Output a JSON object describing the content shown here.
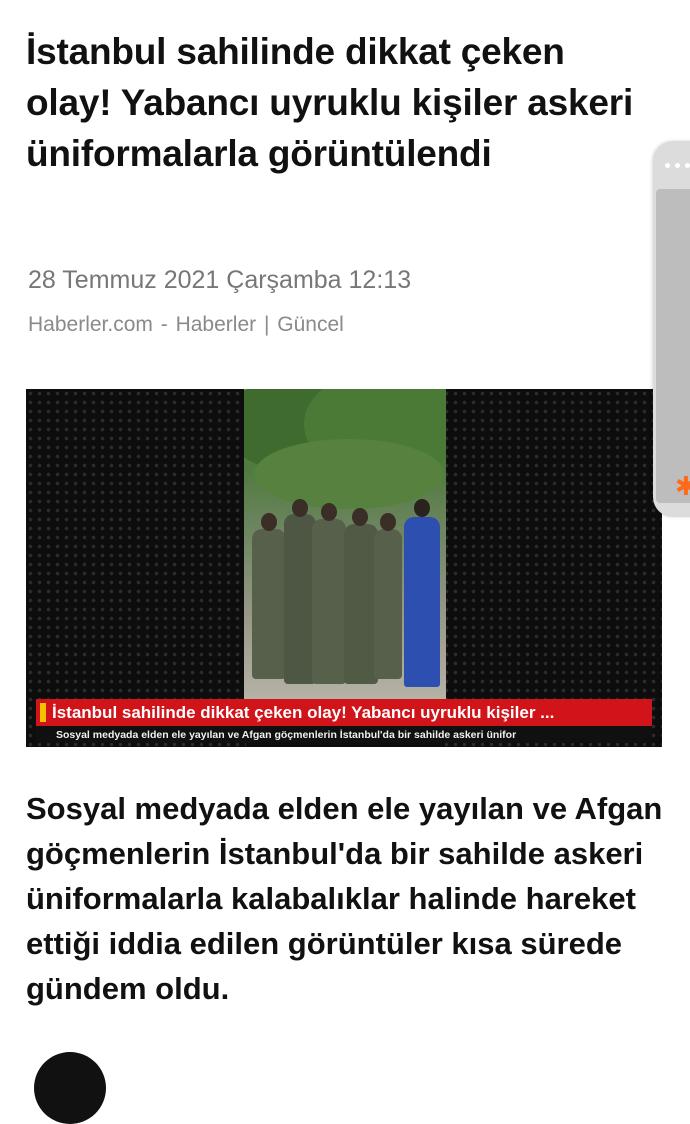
{
  "article": {
    "headline": "İstanbul sahilinde dikkat çeken olay! Yabancı uyruklu kişiler askeri üniformalarla görüntülendi",
    "date": "28 Temmuz 2021 Çarşamba 12:13",
    "source": {
      "site": "Haberler.com",
      "dash": "-",
      "category1": "Haberler",
      "divider": "|",
      "category2": "Güncel"
    },
    "video": {
      "lower_third": "İstanbul sahilinde dikkat çeken olay! Yabancı uyruklu kişiler ...",
      "ticker": "Sosyal medyada elden ele yayılan ve Afgan göçmenlerin İstanbul'da bir sahilde askeri ünifor"
    },
    "lead": "Sosyal medyada elden ele yayılan ve Afgan göçmenlerin İstanbul'da bir sahilde askeri üniformalarla kalabalıklar halinde hareket ettiği iddia edilen görüntüler kısa sürede gündem oldu."
  },
  "colors": {
    "accent_red": "#d1131a",
    "accent_yellow": "#f2c200",
    "text_primary": "#111111",
    "text_muted": "#777777"
  },
  "icons": {
    "side_panel_menu": "three-dots-icon",
    "side_panel_badge": "sparkle-icon"
  }
}
